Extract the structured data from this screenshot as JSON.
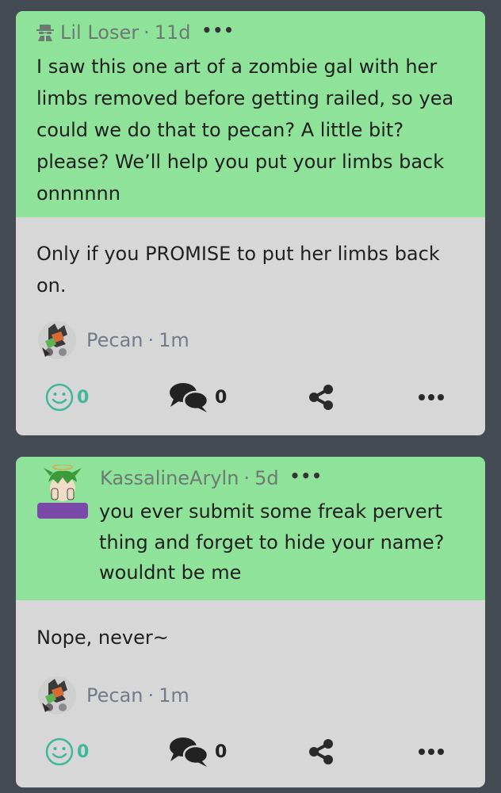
{
  "posts": [
    {
      "question": {
        "author": "Lil Loser",
        "age": "11d",
        "text": "I saw this one art of a zombie gal with her limbs removed before getting railed, so yea could we do that to pecan? A little bit? please? We’ll help you put your limbs back onnnnnn"
      },
      "answer": {
        "text": "Only if you PROMISE to put her limbs back on.",
        "author": "Pecan",
        "age": "1m"
      },
      "actions": {
        "reactions": "0",
        "comments": "0"
      }
    },
    {
      "question": {
        "author": "KassalineAryln",
        "age": "5d",
        "text": "you ever submit some freak pervert thing and forget to hide your name? wouldnt be me"
      },
      "answer": {
        "text": "Nope, never~",
        "author": "Pecan",
        "age": "1m"
      },
      "actions": {
        "reactions": "0",
        "comments": "0"
      }
    }
  ],
  "separator": "·",
  "icons": {
    "anonymous": "spy-icon",
    "reaction": "smiley-icon",
    "comment": "comment-bubbles-icon",
    "share": "share-icon",
    "more": "more-dots-icon"
  },
  "colors": {
    "background": "#444b53",
    "question_bg": "#8fe299",
    "answer_bg": "#d7d7d7",
    "accent": "#3fb89a",
    "muted_text": "#717c8a"
  }
}
